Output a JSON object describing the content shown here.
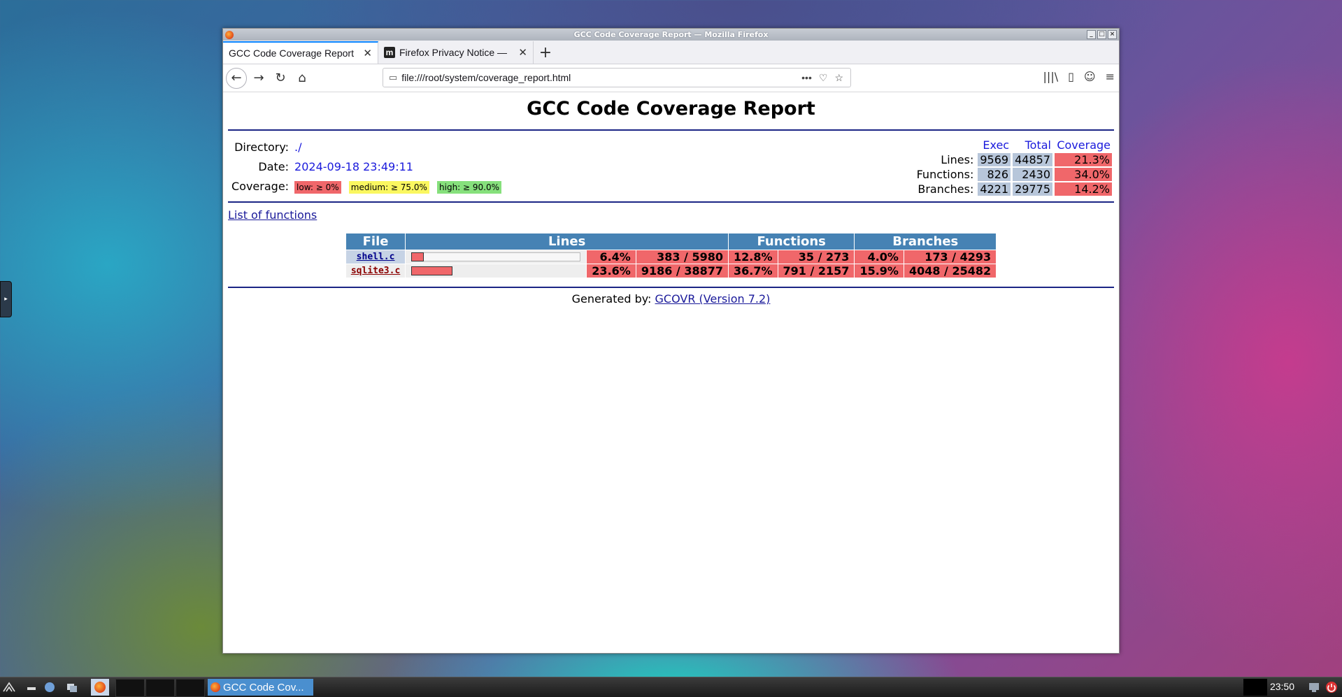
{
  "window": {
    "title": "GCC Code Coverage Report — Mozilla Firefox",
    "buttons": [
      "_",
      "□",
      "×"
    ]
  },
  "tabs": [
    {
      "label": "GCC Code Coverage Report",
      "favicon": "",
      "active": true
    },
    {
      "label": "Firefox Privacy Notice —",
      "favicon": "m",
      "active": false
    }
  ],
  "new_tab_label": "+",
  "navbar": {
    "url": "file:///root/system/coverage_report.html",
    "back_icon": "←",
    "forward_icon": "→",
    "reload_icon": "↻",
    "home_icon": "⌂",
    "page_actions_icon": "•••",
    "pocket_icon": "♡",
    "bookmark_icon": "☆",
    "library_icon": "|||\\",
    "sidebar_icon": "▯",
    "account_icon": "☺",
    "menu_icon": "≡"
  },
  "report": {
    "title": "GCC Code Coverage Report",
    "directory_label": "Directory:",
    "directory": "./",
    "date_label": "Date:",
    "date": "2024-09-18 23:49:11",
    "coverage_label": "Coverage:",
    "legend": {
      "low": "low: ≥ 0%",
      "medium": "medium: ≥ 75.0%",
      "high": "high: ≥ 90.0%"
    },
    "legend_colors": {
      "low": "#f0676a",
      "medium": "#faf760",
      "high": "#86e07c"
    },
    "summary_headers": {
      "exec": "Exec",
      "total": "Total",
      "coverage": "Coverage"
    },
    "summary": [
      {
        "label": "Lines:",
        "exec": "9569",
        "total": "44857",
        "coverage": "21.3%"
      },
      {
        "label": "Functions:",
        "exec": "826",
        "total": "2430",
        "coverage": "34.0%"
      },
      {
        "label": "Branches:",
        "exec": "4221",
        "total": "29775",
        "coverage": "14.2%"
      }
    ],
    "functions_link": "List of functions",
    "file_headers": {
      "file": "File",
      "lines": "Lines",
      "functions": "Functions",
      "branches": "Branches"
    },
    "files": [
      {
        "name": "shell.c",
        "line_fraction": 0.064,
        "lines_pct": "6.4%",
        "lines": "383 / 5980",
        "func_pct": "12.8%",
        "funcs": "35 / 273",
        "branch_pct": "4.0%",
        "branches": "173 / 4293"
      },
      {
        "name": "sqlite3.c",
        "line_fraction": 0.236,
        "lines_pct": "23.6%",
        "lines": "9186 / 38877",
        "func_pct": "36.7%",
        "funcs": "791 / 2157",
        "branch_pct": "15.9%",
        "branches": "4048 / 25482"
      }
    ],
    "generated_by_label": "Generated by:",
    "generated_by_link": "GCOVR (Version 7.2)"
  },
  "taskbar": {
    "task_label": "GCC Code Cov...",
    "clock": "23:50"
  }
}
